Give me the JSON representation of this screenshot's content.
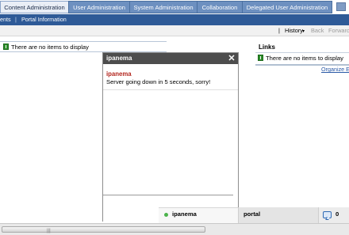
{
  "nav": {
    "tabs": [
      {
        "label": "Content Administration"
      },
      {
        "label": "User Administration"
      },
      {
        "label": "System Administration"
      },
      {
        "label": "Collaboration"
      },
      {
        "label": "Delegated User Administration"
      }
    ]
  },
  "subnav": {
    "items": [
      {
        "label": "ents"
      },
      {
        "label": "Portal Information"
      }
    ],
    "separator": "|"
  },
  "history": {
    "separator": "|",
    "history_label": "History",
    "back_label": "Back",
    "forward_label": "Forward"
  },
  "left_portlet": {
    "empty_text": "There are no items to display"
  },
  "links_portlet": {
    "title": "Links",
    "empty_text": "There are no items to display",
    "organize_label": "Organize E"
  },
  "chat": {
    "title": "ipanema",
    "close_label": "✕",
    "message": {
      "sender": "ipanema",
      "text": "Server going down in 5 seconds, sorry!"
    }
  },
  "chatbar": {
    "user_label": "ipanema",
    "portal_label": "portal",
    "conversation_count": "0"
  },
  "scrollbar": {
    "grip": "|||"
  },
  "colors": {
    "tab_bg": "#6d90c0",
    "subnav_bg": "#2e5a97",
    "chat_header": "#4d4d4d",
    "sender_red": "#b3261e",
    "presence_green": "#4bb34b",
    "info_icon_green": "#2c8d2a"
  }
}
